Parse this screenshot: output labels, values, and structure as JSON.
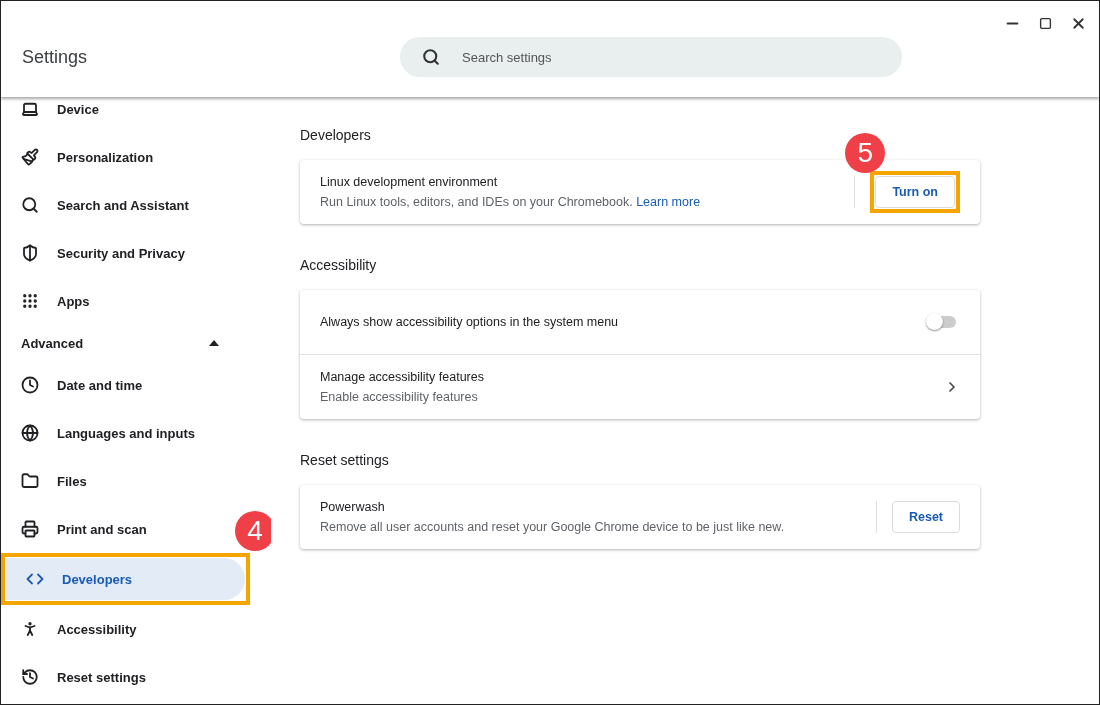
{
  "window": {
    "title": "Settings"
  },
  "search": {
    "placeholder": "Search settings"
  },
  "sidebar": {
    "items": [
      {
        "label": "Device",
        "selected": false
      },
      {
        "label": "Personalization",
        "selected": false
      },
      {
        "label": "Search and Assistant",
        "selected": false
      },
      {
        "label": "Security and Privacy",
        "selected": false
      },
      {
        "label": "Apps",
        "selected": false
      }
    ],
    "advanced": {
      "label": "Advanced",
      "expanded": true,
      "items": [
        {
          "label": "Date and time",
          "selected": false
        },
        {
          "label": "Languages and inputs",
          "selected": false
        },
        {
          "label": "Files",
          "selected": false
        },
        {
          "label": "Print and scan",
          "selected": false
        },
        {
          "label": "Developers",
          "selected": true,
          "callout": "4"
        },
        {
          "label": "Accessibility",
          "selected": false
        },
        {
          "label": "Reset settings",
          "selected": false
        }
      ]
    }
  },
  "sections": [
    {
      "title": "Developers",
      "rows": [
        {
          "kind": "button",
          "title": "Linux development environment",
          "description": "Run Linux tools, editors, and IDEs on your Chromebook.",
          "link": "Learn more",
          "button": "Turn on",
          "callout": "5"
        }
      ]
    },
    {
      "title": "Accessibility",
      "rows": [
        {
          "kind": "toggle",
          "title": "Always show accessibility options in the system menu",
          "on": false
        },
        {
          "kind": "submenu",
          "title": "Manage accessibility features",
          "description": "Enable accessibility features"
        }
      ]
    },
    {
      "title": "Reset settings",
      "rows": [
        {
          "kind": "button",
          "title": "Powerwash",
          "description": "Remove all user accounts and reset your Google Chrome device to be just like new.",
          "button": "Reset"
        }
      ]
    }
  ]
}
